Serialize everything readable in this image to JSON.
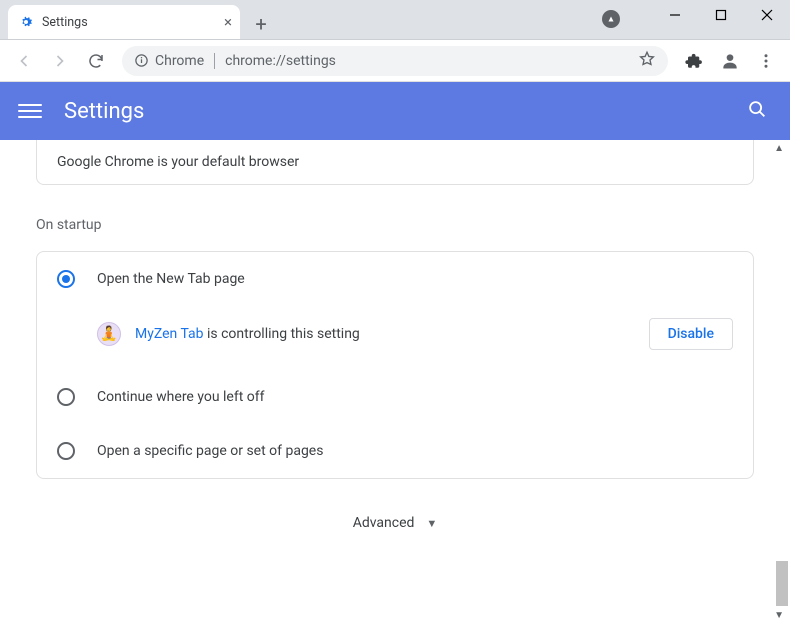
{
  "window": {
    "tab_title": "Settings"
  },
  "toolbar": {
    "url_label": "Chrome",
    "url": "chrome://settings"
  },
  "header": {
    "title": "Settings"
  },
  "default_browser": {
    "message": "Google Chrome is your default browser"
  },
  "startup": {
    "section_title": "On startup",
    "options": {
      "new_tab": "Open the New Tab page",
      "continue": "Continue where you left off",
      "specific": "Open a specific page or set of pages"
    },
    "controlled_by": {
      "name": "MyZen Tab",
      "suffix": " is controlling this setting",
      "disable_label": "Disable"
    }
  },
  "advanced_label": "Advanced"
}
